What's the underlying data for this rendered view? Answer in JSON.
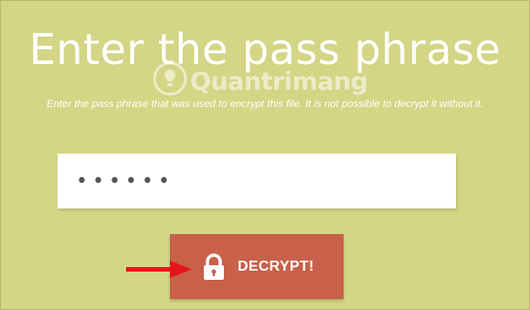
{
  "page": {
    "title": "Enter the pass phrase",
    "subtitle": "Enter the pass phrase that was used to encrypt this file. It is not possible to decrypt it without it."
  },
  "watermark": {
    "text": "Quantrimang"
  },
  "pass_field": {
    "value": "••••••"
  },
  "decrypt_button": {
    "label": "DECRYPT!",
    "icon": "lock-icon"
  },
  "annotation": {
    "icon": "red-arrow-icon",
    "color": "#e8141a"
  },
  "colors": {
    "background": "#d4d585",
    "button": "#c8604a",
    "text": "#ffffff"
  }
}
